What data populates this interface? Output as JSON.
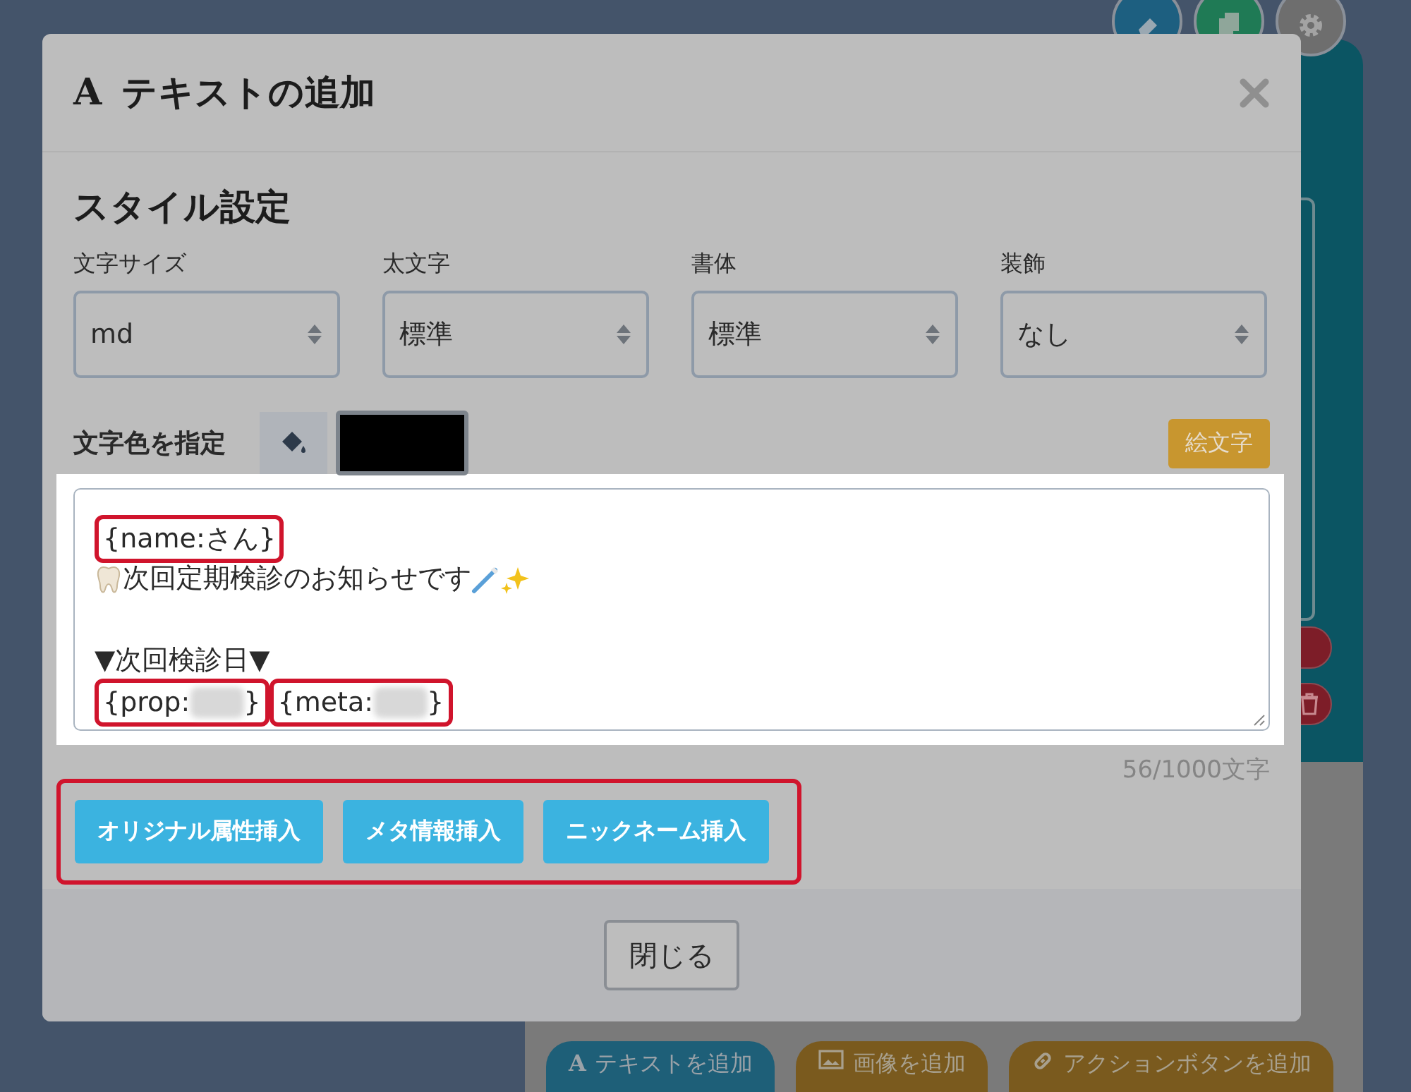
{
  "fab_buttons": [
    {
      "kind": "eraser"
    },
    {
      "kind": "copy"
    },
    {
      "kind": "gear"
    }
  ],
  "side_buttons": [
    {
      "kind": "pill"
    },
    {
      "kind": "trash"
    }
  ],
  "toolbar_buttons": [
    {
      "kind": "text",
      "glyph": "A",
      "label": "テキストを追加"
    },
    {
      "kind": "image",
      "label": "画像を追加"
    },
    {
      "kind": "link",
      "label": "アクションボタンを追加"
    }
  ],
  "modal": {
    "title_glyph": "A",
    "title": "テキストの追加",
    "section_title": "スタイル設定",
    "selects": [
      {
        "label": "文字サイズ",
        "value": "md"
      },
      {
        "label": "太文字",
        "value": "標準"
      },
      {
        "label": "書体",
        "value": "標準"
      },
      {
        "label": "装飾",
        "value": "なし"
      }
    ],
    "color_picker": {
      "label": "文字色を指定",
      "color": "#000000"
    },
    "emoji_button": "絵文字",
    "message": {
      "lines": [
        {
          "kind": "text",
          "segments": [
            {
              "kind": "token",
              "text": "{name:さん}",
              "redacted": false,
              "annotated": true
            }
          ]
        },
        {
          "kind": "text",
          "segments": [
            {
              "kind": "tooth"
            },
            {
              "kind": "text",
              "text": "次回定期検診のお知らせです"
            },
            {
              "kind": "brush"
            },
            {
              "kind": "sparkle"
            }
          ]
        },
        {
          "kind": "blank"
        },
        {
          "kind": "text",
          "segments": [
            {
              "kind": "text",
              "text": "▼次回検診日▼"
            }
          ]
        },
        {
          "kind": "text",
          "segments": [
            {
              "kind": "token",
              "text": "{prop:",
              "redacted": true,
              "end": "}",
              "annotated": true
            },
            {
              "kind": "token",
              "text": "{meta:",
              "redacted": true,
              "end": "}",
              "annotated": true
            }
          ]
        }
      ]
    },
    "counter": "56/1000文字",
    "insert_buttons": [
      "オリジナル属性挿入",
      "メタ情報挿入",
      "ニックネーム挿入"
    ],
    "insert_buttons_annotated": true,
    "close_button": "閉じる"
  }
}
